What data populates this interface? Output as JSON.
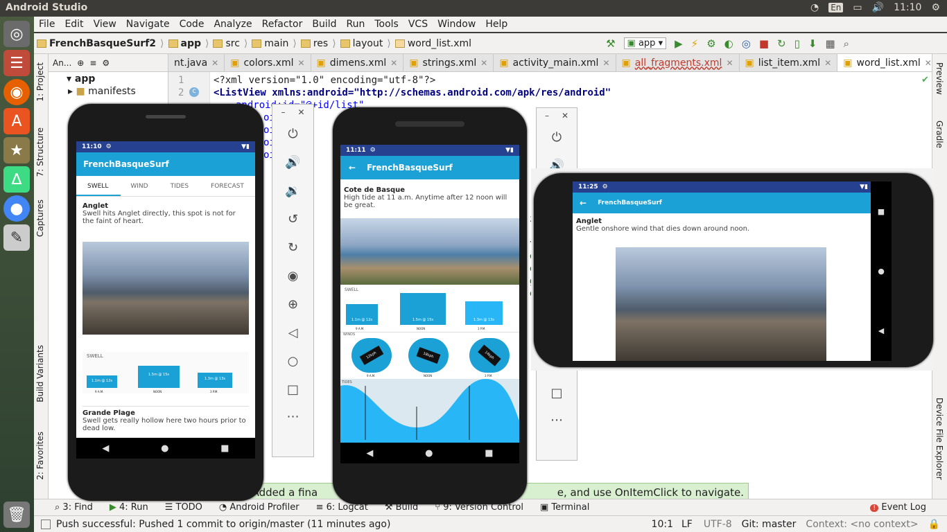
{
  "topbar": {
    "title": "Android Studio",
    "lang": "En",
    "time": "11:10"
  },
  "menu": [
    "File",
    "Edit",
    "View",
    "Navigate",
    "Code",
    "Analyze",
    "Refactor",
    "Build",
    "Run",
    "Tools",
    "VCS",
    "Window",
    "Help"
  ],
  "breadcrumbs": [
    "FrenchBasqueSurf2",
    "app",
    "src",
    "main",
    "res",
    "layout",
    "word_list.xml"
  ],
  "run_config": "app",
  "project": {
    "selector": "An...",
    "items": [
      {
        "label": "app"
      },
      {
        "label": "manifests"
      }
    ]
  },
  "tabs": [
    "nt.java",
    "colors.xml",
    "dimens.xml",
    "strings.xml",
    "activity_main.xml",
    "all_fragments.xml",
    "list_item.xml",
    "word_list.xml"
  ],
  "code": {
    "line1": "<?xml version=\"1.0\" encoding=\"utf-8\"?>",
    "line2": "<ListView xmlns:android=\"http://schemas.android.com/apk/res/android\"",
    "line3": "android:id=\"@+id/list\"",
    "frag_lines": [
      "oi",
      "oi",
      "oi",
      "oi"
    ],
    "frag_right": [
      "i",
      "t",
      "e",
      "e",
      "g",
      "o"
    ]
  },
  "left_tabs": [
    "1: Project",
    "7: Structure",
    "Captures",
    "Build Variants",
    "2: Favorites"
  ],
  "right_tabs": [
    "Preview",
    "Gradle",
    "Device File Explorer"
  ],
  "balloon": {
    "left": "ed: Added a fina",
    "right": "e, and use OnItemClick to navigate."
  },
  "bottom_tools": [
    "3: Find",
    "4: Run",
    "TODO",
    "Android Profiler",
    "6: Logcat",
    "Build",
    "9: Version Control",
    "Terminal",
    "Event Log"
  ],
  "status": {
    "message": "Push successful: Pushed 1 commit to origin/master (11 minutes ago)",
    "pos": "10:1",
    "lf": "LF",
    "enc": "UTF-8",
    "git": "Git: master",
    "context": "Context: <no context>"
  },
  "phone1": {
    "time": "11:10",
    "app": "FrenchBasqueSurf",
    "tabs": [
      "SWELL",
      "WIND",
      "TIDES",
      "FORECAST"
    ],
    "spot1": "Anglet",
    "desc1": "Swell hits Anglet directly, this spot is not for the faint of heart.",
    "swell_label": "SWELL",
    "bars": [
      {
        "label": "1.1m @ 12s",
        "time": "9 A.M."
      },
      {
        "label": "1.5m @ 15s",
        "time": "NOON"
      },
      {
        "label": "1.3m @ 13s",
        "time": "3 P.M."
      }
    ],
    "spot2": "Grande Plage",
    "desc2": "Swell gets really hollow here two hours prior to dead low."
  },
  "phone2": {
    "time": "11:11",
    "app": "FrenchBasqueSurf",
    "spot": "Cote de Basque",
    "desc": "High tide at 11 a.m. Anytime after 12 noon will be great.",
    "swell_label": "SWELL",
    "bars": [
      {
        "label": "1.1m @ 12s",
        "time": "9 A.M."
      },
      {
        "label": "1.5m @ 15s",
        "time": "NOON"
      },
      {
        "label": "1.3m @ 13s",
        "time": "3 P.M."
      }
    ],
    "winds_label": "WINDS",
    "winds": [
      {
        "label": "12kph",
        "time": "9 A.M."
      },
      {
        "label": "18kph",
        "time": "NOON"
      },
      {
        "label": "14kph",
        "time": "3 P.M."
      }
    ],
    "tides_label": "TIDES"
  },
  "phone3": {
    "time": "11:25",
    "app": "FrenchBasqueSurf",
    "spot": "Anglet",
    "desc": "Gentle onshore wind that dies down around noon."
  },
  "colors": {
    "appbar": "#1ba1d6",
    "statusbar": "#26418f",
    "bars": "#1ba1d6"
  }
}
